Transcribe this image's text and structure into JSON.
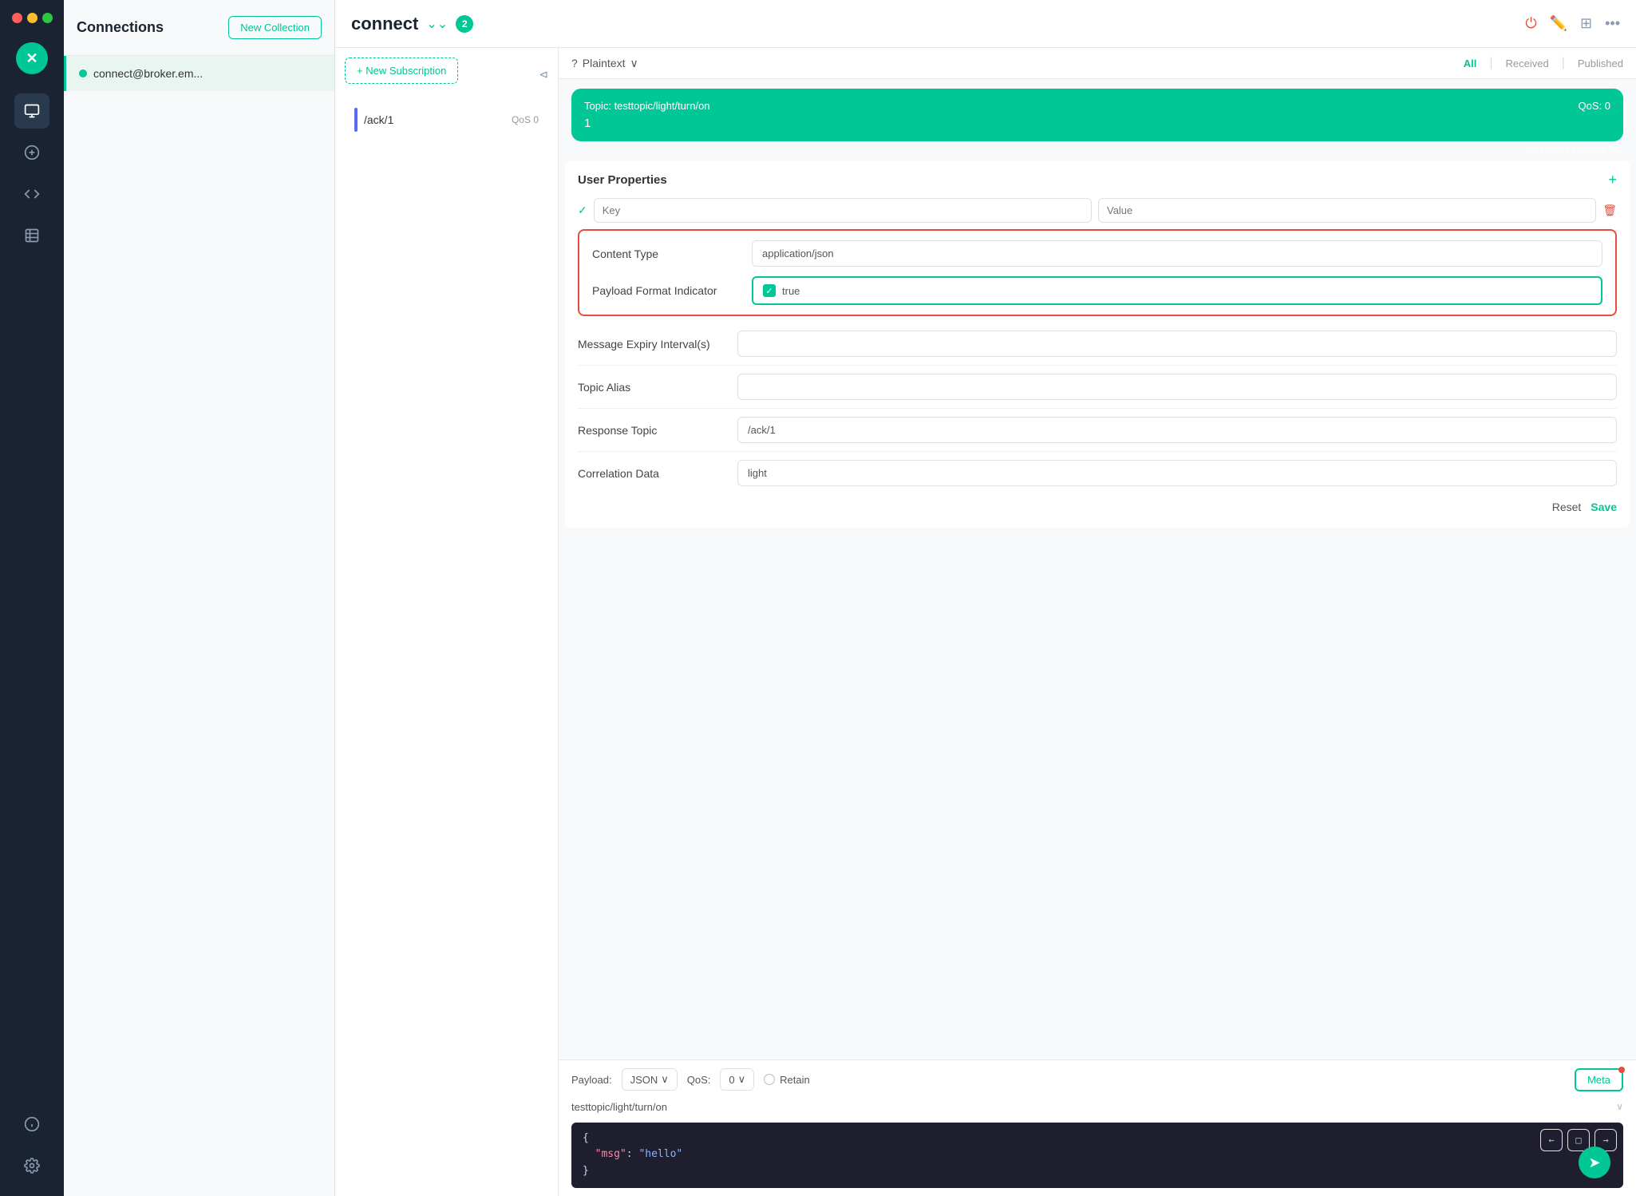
{
  "sidebar": {
    "title": "Connections",
    "logo_text": "✕",
    "new_collection_label": "New Collection",
    "icons": [
      "copy",
      "add",
      "code",
      "table",
      "info",
      "settings"
    ]
  },
  "connection": {
    "name": "connect@broker.em...",
    "status": "connected"
  },
  "topbar": {
    "title": "connect",
    "badge_count": "2",
    "icons": [
      "power",
      "edit",
      "add",
      "more"
    ]
  },
  "subscriptions": {
    "new_sub_label": "+ New Subscription",
    "items": [
      {
        "name": "/ack/1",
        "qos": "QoS 0"
      }
    ]
  },
  "messages": {
    "format_label": "Plaintext",
    "filter_all": "All",
    "filter_received": "Received",
    "filter_published": "Published",
    "bubble": {
      "topic": "Topic: testtopic/light/turn/on",
      "qos": "QoS: 0",
      "payload": "1",
      "timestamp": "2021-12-14 15:03:46.442"
    }
  },
  "properties": {
    "user_props_title": "User Properties",
    "key_placeholder": "Key",
    "value_placeholder": "Value",
    "content_type_label": "Content Type",
    "content_type_value": "application/json",
    "payload_format_label": "Payload Format Indicator",
    "payload_format_value": "true",
    "message_expiry_label": "Message Expiry Interval(s)",
    "message_expiry_value": "",
    "topic_alias_label": "Topic Alias",
    "topic_alias_value": "",
    "response_topic_label": "Response Topic",
    "response_topic_value": "/ack/1",
    "correlation_data_label": "Correlation Data",
    "correlation_data_value": "light",
    "reset_label": "Reset",
    "save_label": "Save"
  },
  "compose": {
    "payload_label": "Payload:",
    "payload_format": "JSON",
    "qos_label": "QoS:",
    "qos_value": "0",
    "retain_label": "Retain",
    "meta_label": "Meta",
    "topic": "testtopic/light/turn/on",
    "editor_lines": [
      "{",
      "  \"msg\": \"hello\"",
      "}"
    ]
  }
}
